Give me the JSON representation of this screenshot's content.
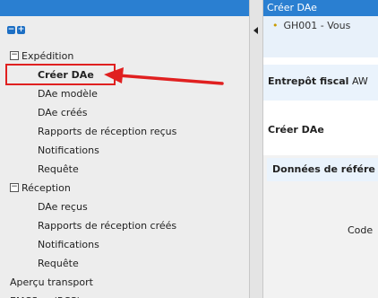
{
  "tree": [
    {
      "label": "Expédition",
      "level": 0,
      "toggle": "⊟"
    },
    {
      "label": "Créer DAe",
      "level": 1,
      "selected": true
    },
    {
      "label": "DAe modèle",
      "level": 1
    },
    {
      "label": "DAe créés",
      "level": 1
    },
    {
      "label": "Rapports de réception reçus",
      "level": 1
    },
    {
      "label": "Notifications",
      "level": 1
    },
    {
      "label": "Requête",
      "level": 1
    },
    {
      "label": "Réception",
      "level": 0,
      "toggle": "⊟"
    },
    {
      "label": "DAe reçus",
      "level": 1
    },
    {
      "label": "Rapports de réception créés",
      "level": 1
    },
    {
      "label": "Notifications",
      "level": 1
    },
    {
      "label": "Requête",
      "level": 1
    },
    {
      "label": "Aperçu transport",
      "level": 0
    },
    {
      "label": "EMCS ... (RCS)",
      "level": 0
    }
  ],
  "tree_tools": {
    "collapse": "−",
    "expand": "+"
  },
  "right": {
    "title": "Créer DAe",
    "message": "GH001 - Vous",
    "entrepot_label": "Entrepôt fiscal",
    "entrepot_value": "AW",
    "creer_heading": "Créer DAe",
    "ref_heading": "Données de référe",
    "code_label": "Code"
  },
  "colors": {
    "header_blue": "#2a7fd1",
    "annotation_red": "#e02020",
    "left_bg": "#ededed"
  }
}
